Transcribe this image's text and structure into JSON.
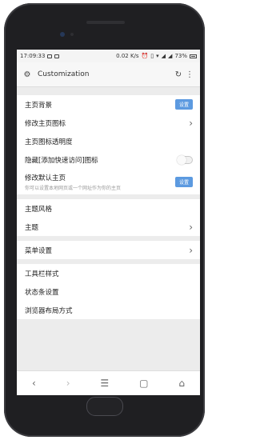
{
  "status": {
    "time": "17:09:33",
    "speed": "0.02 K/s",
    "battery": "73%"
  },
  "appbar": {
    "title": "Customization",
    "icons": [
      "settings-gear-icon",
      "refresh-icon",
      "more-vert-icon"
    ]
  },
  "section1": {
    "homepage_background": {
      "label": "主页背景",
      "button": "设置"
    },
    "modify_home_icon": {
      "label": "修改主页图标"
    },
    "home_icon_transparency": {
      "label": "主页图标透明度"
    },
    "hide_quick_access": {
      "label": "隐藏[添加快速访问]图标"
    },
    "set_default_home": {
      "label": "修改默认主页",
      "sub": "你可以设置本地网页或一个网址作为你的主页",
      "button": "设置"
    }
  },
  "section2": {
    "theme_style": {
      "label": "主题风格"
    },
    "theme": {
      "label": "主题"
    }
  },
  "section3": {
    "menu_settings": {
      "label": "菜单设置"
    }
  },
  "section4": {
    "toolbar_style": {
      "label": "工具栏样式"
    },
    "statusbar_settings": {
      "label": "状态条设置"
    },
    "browser_layout": {
      "label": "浏览器布局方式"
    }
  },
  "colors": {
    "accent": "#5c9ae0",
    "background": "#ececec",
    "phone": "#1f1f22"
  }
}
